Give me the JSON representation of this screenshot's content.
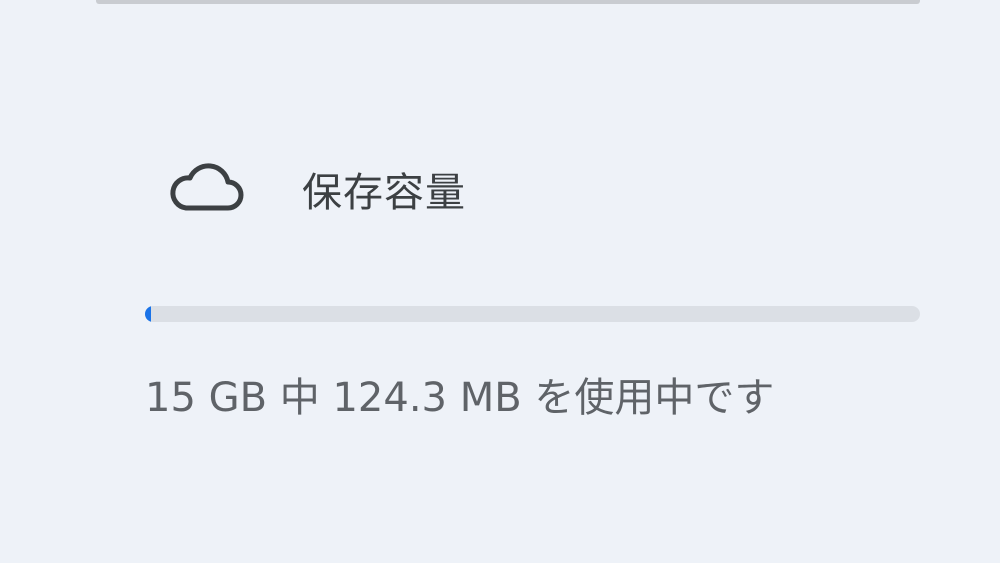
{
  "storage": {
    "label": "保存容量",
    "icon": "cloud-icon",
    "usage_text": "15 GB 中 124.3 MB を使用中です",
    "used_fraction": 0.008,
    "accent_color": "#1a73e8",
    "track_color": "#dbdfe5"
  }
}
